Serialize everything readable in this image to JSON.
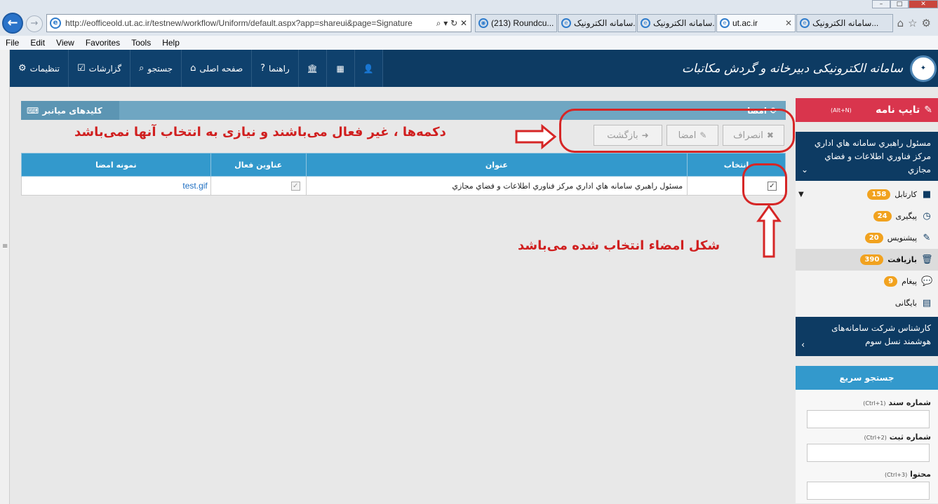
{
  "browser": {
    "address_url": "http://eofficeold.ut.ac.ir/testnew/workflow/Uniform/default.aspx?app=shareui&page=Signature",
    "address_domain": "ut.ac.ir",
    "tabs": [
      {
        "label": "(213) Roundcu..."
      },
      {
        "label": "سامانه الکترونیک..."
      },
      {
        "label": "سامانه الکترونیک..."
      },
      {
        "label": "ut.ac.ir"
      },
      {
        "label": "سامانه الکترونیک..."
      }
    ],
    "menu": [
      "File",
      "Edit",
      "View",
      "Favorites",
      "Tools",
      "Help"
    ]
  },
  "header": {
    "brand_title": "سامانه الکترونیکی دبیرخانه و گردش مکاتبات",
    "nav": {
      "settings": "تنظیمات",
      "reports": "گزارشات",
      "search": "جستجو",
      "home": "صفحه اصلی",
      "help": "راهنما"
    }
  },
  "main": {
    "shortcuts_label": "کلیدهای میانبر",
    "section_title": "امضا",
    "buttons": {
      "cancel": "انصراف",
      "sign": "امضا",
      "back": "بازگشت"
    },
    "table": {
      "headers": {
        "select": "انتخاب",
        "title": "عنوان",
        "active_titles": "عناوین فعال",
        "sample": "نمونه امضا"
      },
      "rows": [
        {
          "title": "مسئول راهبري سامانه هاي اداري مركز فناوري اطلاعات و فضاي مجازي",
          "sample": "test.gif"
        }
      ]
    },
    "annotations": {
      "buttons_note": "دکمه‌ها ، غیر فعال می‌باشند و نیازی به انتخاب آنها نمی‌باشد",
      "selected_note": "شکل امضاء انتخاب شده می‌باشد"
    },
    "colors": {
      "annotation_red": "#d01f1f",
      "header_navy": "#0d3b63",
      "table_header": "#3399cc"
    }
  },
  "sidebar": {
    "compose_label": "تایپ نامه",
    "compose_hotkey": "(Alt+N)",
    "user_position": "مسئول راهبري سامانه هاي اداري مركز فناوري اطلاعات و فضاي مجازي",
    "items": [
      {
        "label": "کارتابل",
        "badge": "158"
      },
      {
        "label": "پیگیری",
        "badge": "24"
      },
      {
        "label": "پیشنویس",
        "badge": "20"
      },
      {
        "label": "بازیافت",
        "badge": "390"
      },
      {
        "label": "پیغام",
        "badge": "9"
      },
      {
        "label": "بایگانی",
        "badge": ""
      }
    ],
    "role": "کارشناس شرکت سامانه‌های هوشمند نسل سوم",
    "quick_search": {
      "title": "جستجو سریع",
      "doc_number": "شماره سند",
      "doc_hotkey": "(Ctrl+1)",
      "reg_number": "شماره ثبت",
      "reg_hotkey": "(Ctrl+2)",
      "content": "محتوا",
      "content_hotkey": "(Ctrl+3)"
    }
  }
}
